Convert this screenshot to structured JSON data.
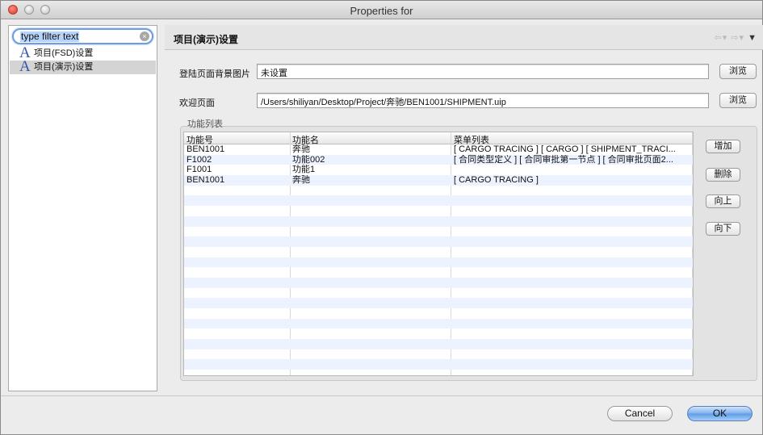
{
  "window": {
    "title": "Properties for"
  },
  "filter": {
    "value": "type filter text"
  },
  "tree": {
    "items": [
      {
        "label": "项目(FSD)设置",
        "icon": "font-A-icon",
        "selected": false
      },
      {
        "label": "项目(演示)设置",
        "icon": "font-A-icon",
        "selected": true
      }
    ]
  },
  "page": {
    "title": "项目(演示)设置",
    "bg_label": "登陆页面背景图片",
    "bg_value": "未设置",
    "welcome_label": "欢迎页面",
    "welcome_value": "/Users/shiliyan/Desktop/Project/奔驰/BEN1001/SHIPMENT.uip",
    "browse_label": "浏览",
    "group_title": "功能列表"
  },
  "table": {
    "headers": [
      "功能号",
      "功能名",
      "菜单列表"
    ],
    "rows": [
      [
        "BEN1001",
        "奔驰",
        "[ CARGO TRACING ] [ CARGO ] [ SHIPMENT_TRACI..."
      ],
      [
        "F1002",
        "功能002",
        "[ 合同类型定义 ] [ 合同审批第一节点 ] [ 合同审批页面2..."
      ],
      [
        "F1001",
        "功能1",
        ""
      ],
      [
        "BEN1001",
        "奔驰",
        "[ CARGO TRACING ]"
      ]
    ],
    "empty_rows": 18
  },
  "buttons": {
    "add": "增加",
    "delete": "删除",
    "up": "向上",
    "down": "向下",
    "cancel": "Cancel",
    "ok": "OK"
  },
  "colors": {
    "accent": "#5d9be6",
    "selection": "#b6d3fb",
    "row_alt": "#edf3fe"
  }
}
